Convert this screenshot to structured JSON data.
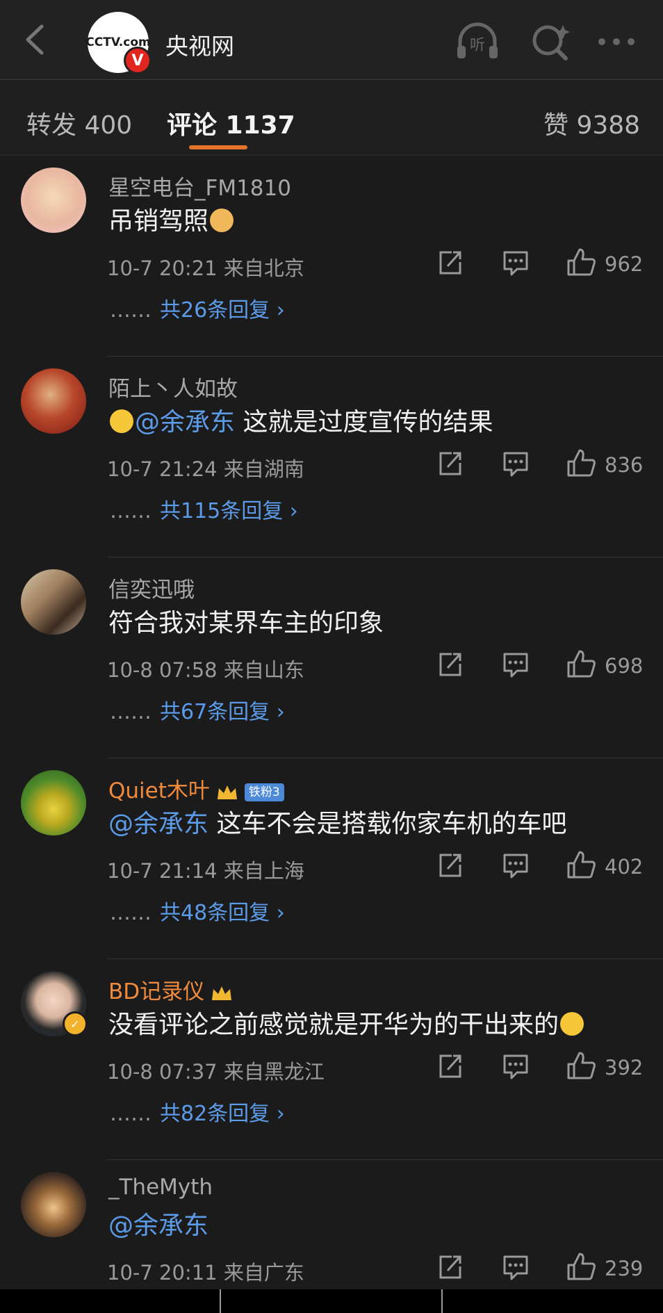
{
  "header": {
    "title": "央视网",
    "logo_text": "CCTV.com",
    "verified_mark": "V"
  },
  "tabs": [
    {
      "label": "转发 400"
    },
    {
      "label": "评论 1137"
    },
    {
      "label": "赞 9388"
    }
  ],
  "comments": [
    {
      "username": "星空电台_FM1810",
      "text_prefix": "",
      "mention": "",
      "text": "吊销驾照",
      "meta": "10-7 20:21  来自北京",
      "likes": "962",
      "replies_prefix": "……",
      "replies": "共26条回复 ›"
    },
    {
      "username": "陌上丶人如故",
      "text_prefix": "",
      "mention": "@余承东",
      "text": " 这就是过度宣传的结果",
      "meta": "10-7 21:24  来自湖南",
      "likes": "836",
      "replies_prefix": "……",
      "replies": "共115条回复 ›"
    },
    {
      "username": "信奕迅哦",
      "text_prefix": "",
      "mention": "",
      "text": "符合我对某界车主的印象",
      "meta": "10-8 07:58  来自山东",
      "likes": "698",
      "replies_prefix": "……",
      "replies": "共67条回复 ›"
    },
    {
      "username": "Quiet木叶",
      "badge": "铁粉3",
      "mention": "@余承东",
      "text": " 这车不会是搭载你家车机的车吧",
      "meta": "10-7 21:14  来自上海",
      "likes": "402",
      "replies_prefix": "……",
      "replies": "共48条回复 ›"
    },
    {
      "username": "BD记录仪",
      "mention": "",
      "text": "没看评论之前感觉就是开华为的干出来的",
      "meta": "10-8 07:37  来自黑龙江",
      "likes": "392",
      "replies_prefix": "……",
      "replies": "共82条回复 ›"
    },
    {
      "username": "_TheMyth",
      "mention": "@余承东",
      "text": "",
      "meta": "10-7 20:11  来自广东",
      "likes": "239"
    }
  ],
  "colors": {
    "accent": "#e4732a",
    "link": "#5c9be8",
    "vip_name": "#f08a3c"
  }
}
